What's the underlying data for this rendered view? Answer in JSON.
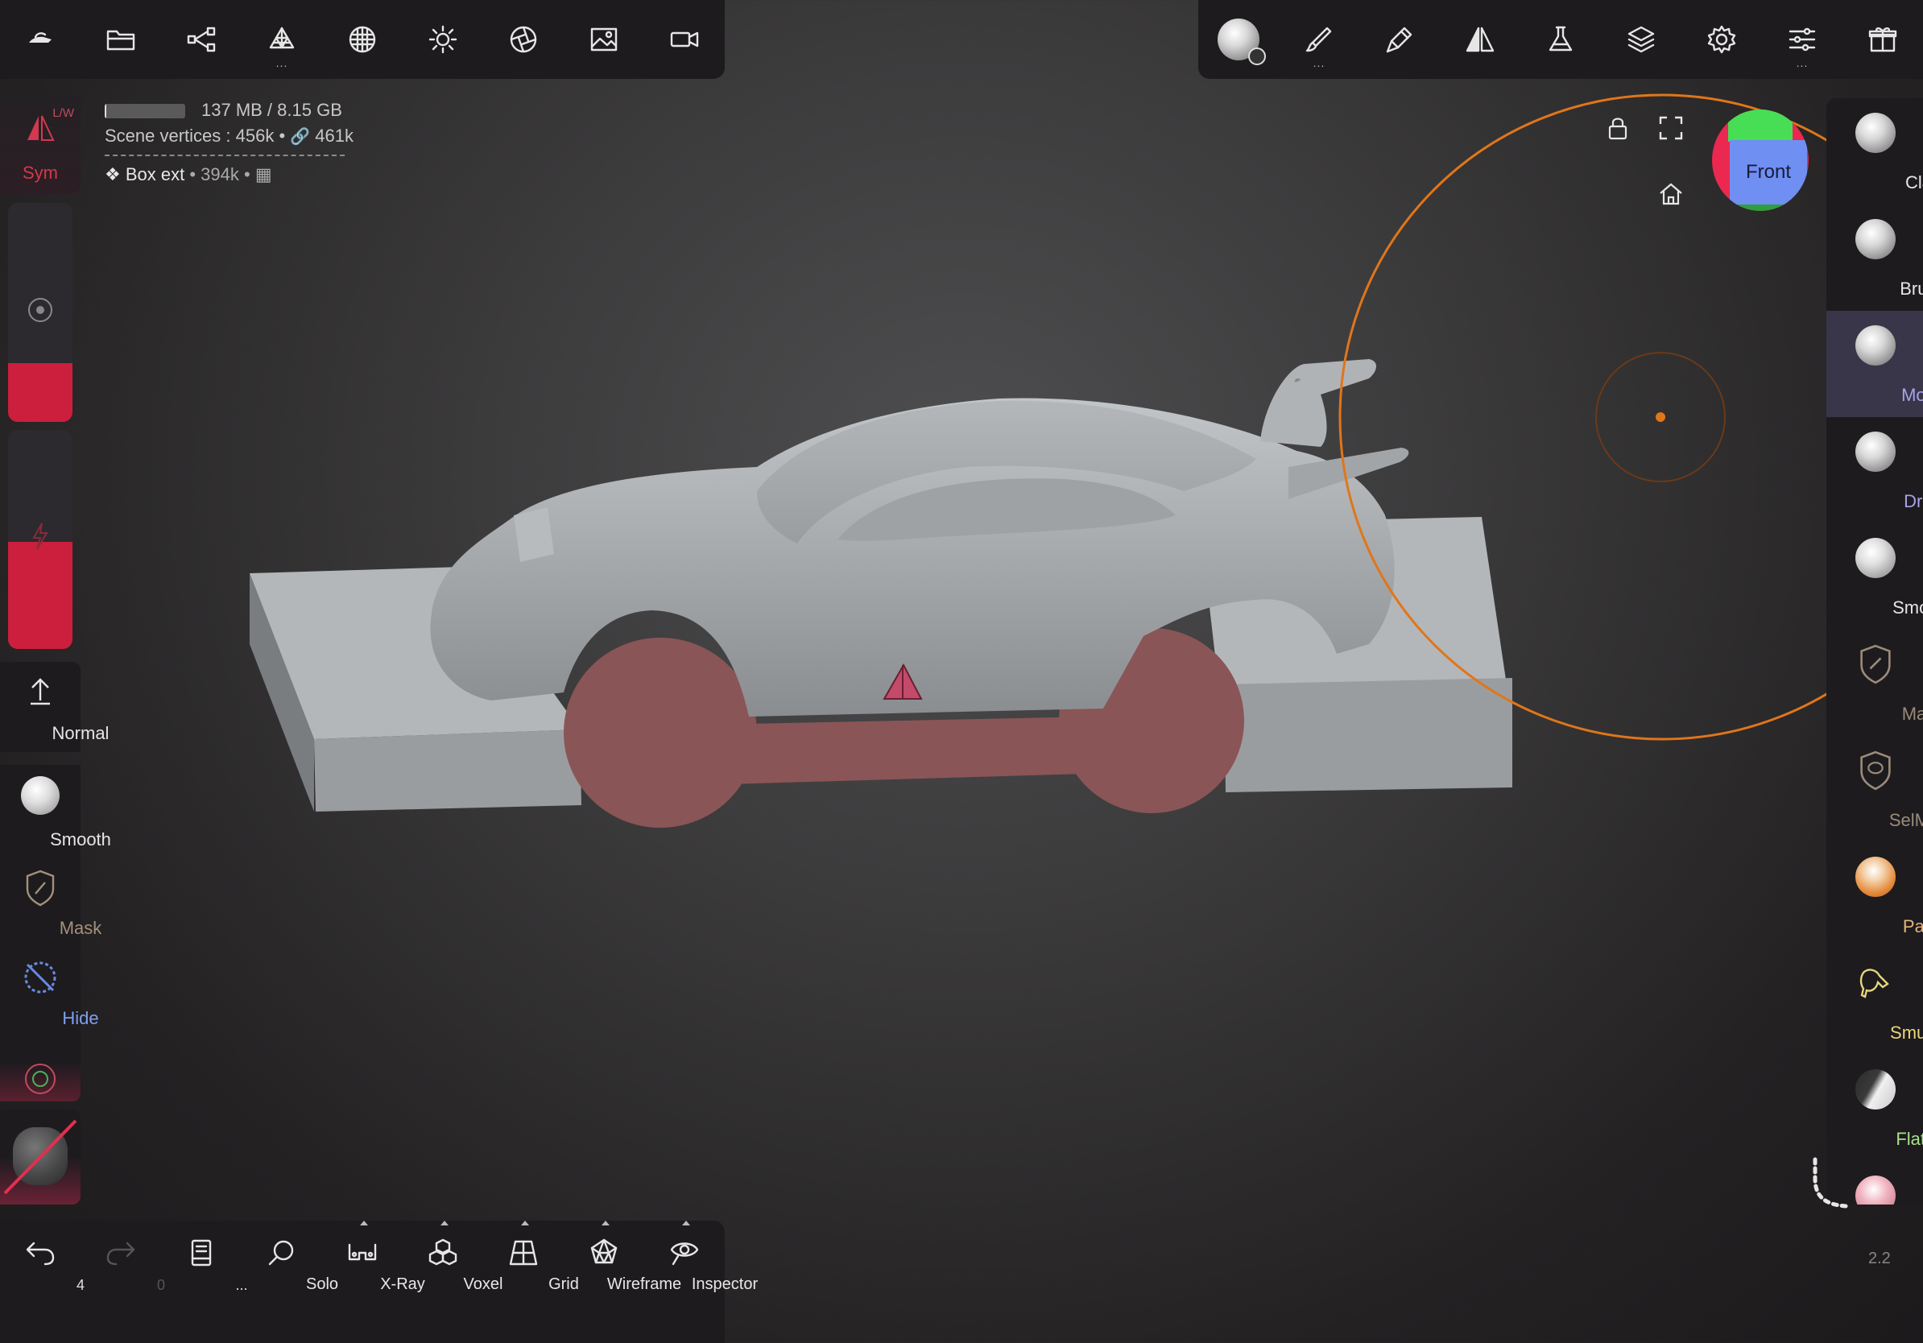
{
  "top_left_toolbar": {
    "items": [
      {
        "icon": "nomad-logo-icon"
      },
      {
        "icon": "folder-icon"
      },
      {
        "icon": "scene-graph-icon"
      },
      {
        "icon": "mesh-icon"
      },
      {
        "icon": "topology-icon"
      },
      {
        "icon": "light-icon"
      },
      {
        "icon": "post-process-icon"
      },
      {
        "icon": "background-icon"
      },
      {
        "icon": "camera-icon"
      }
    ]
  },
  "top_right_toolbar": {
    "items": [
      {
        "icon": "material-icon"
      },
      {
        "icon": "painting-icon"
      },
      {
        "icon": "stroke-icon"
      },
      {
        "icon": "symmetry-icon"
      },
      {
        "icon": "tool-settings-icon"
      },
      {
        "icon": "layers-icon"
      },
      {
        "icon": "settings-icon"
      },
      {
        "icon": "interface-icon"
      },
      {
        "icon": "gift-icon"
      }
    ]
  },
  "info": {
    "memory": "137 MB / 8.15 GB",
    "memory_fraction": 0.017,
    "vertices": "Scene vertices : 456k • ",
    "links": "461k",
    "object": "Box ext",
    "object_vertices": "• 394k •"
  },
  "left_panel": {
    "sym_label": "Sym",
    "sym_badge": "L/W",
    "radius_fraction": 0.27,
    "intensity_fraction": 0.49,
    "normal_label": "Normal",
    "smooth_label": "Smooth",
    "mask_label": "Mask",
    "hide_label": "Hide"
  },
  "right_tools": [
    {
      "label": "Clay",
      "color": "#e6e6e6",
      "icon": "clay-sphere-icon"
    },
    {
      "label": "Brush",
      "color": "#e6e6e6",
      "icon": "brush-sphere-icon"
    },
    {
      "label": "Move",
      "color": "#a7a3e8",
      "icon": "move-sphere-icon"
    },
    {
      "label": "Drag",
      "color": "#a7a3e8",
      "icon": "drag-sphere-icon"
    },
    {
      "label": "Smooth",
      "color": "#e6e6e6",
      "icon": "smooth-sphere-icon"
    },
    {
      "label": "Mask",
      "color": "#9a8b7a",
      "icon": "mask-shield-icon"
    },
    {
      "label": "SelMask",
      "color": "#9a8b7a",
      "icon": "selmask-shield-icon"
    },
    {
      "label": "Paint",
      "color": "#e5b47a",
      "icon": "paint-sphere-icon"
    },
    {
      "label": "Smudge",
      "color": "#e8d77a",
      "icon": "smudge-icon"
    },
    {
      "label": "Flatten",
      "color": "#a8e08a",
      "icon": "flatten-sphere-icon"
    }
  ],
  "bottom_toolbar": {
    "undo_count": "4",
    "redo_count": "0",
    "scene_dots": "...",
    "solo": "Solo",
    "xray": "X-Ray",
    "voxel": "Voxel",
    "grid": "Grid",
    "wireframe": "Wireframe",
    "inspector": "Inspector"
  },
  "view_cube": {
    "label": "Front"
  },
  "version": "2.2",
  "colors": {
    "accent": "#cc1f3d",
    "brush_ring": "#e0761a",
    "masked": "#8a5556",
    "mesh": "#a6a9ac"
  }
}
